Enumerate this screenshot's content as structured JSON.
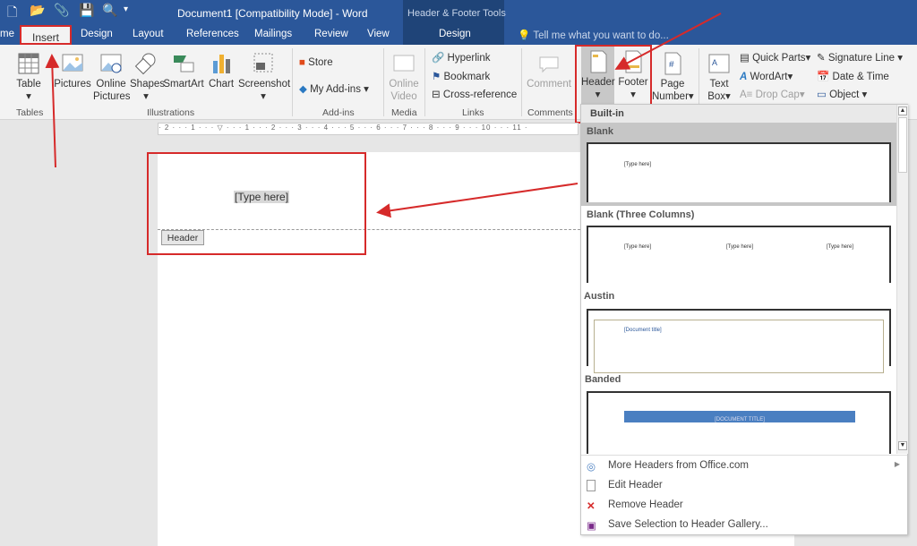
{
  "window": {
    "title": "Document1 [Compatibility Mode] - Word",
    "context_group": "Header & Footer Tools"
  },
  "tabs": [
    {
      "label": "me"
    },
    {
      "label": "Insert"
    },
    {
      "label": "Design"
    },
    {
      "label": "Layout"
    },
    {
      "label": "References"
    },
    {
      "label": "Mailings"
    },
    {
      "label": "Review"
    },
    {
      "label": "View"
    },
    {
      "label": "Design"
    }
  ],
  "tell_me": "Tell me what you want to do...",
  "ribbon": {
    "table": "Table",
    "pictures": "Pictures",
    "online_pictures": "Online Pictures",
    "shapes": "Shapes",
    "smartart": "SmartArt",
    "chart": "Chart",
    "screenshot": "Screenshot",
    "store": "Store",
    "my_addins": "My Add-ins",
    "online_video": "Online Video",
    "hyperlink": "Hyperlink",
    "bookmark": "Bookmark",
    "cross_reference": "Cross-reference",
    "comment": "Comment",
    "header": "Header",
    "footer": "Footer",
    "page_number": "Page Number",
    "text_box": "Text Box",
    "quick_parts": "Quick Parts",
    "wordart": "WordArt",
    "drop_cap": "Drop Cap",
    "signature_line": "Signature Line",
    "date_time": "Date & Time",
    "object": "Object",
    "groups": {
      "tables": "Tables",
      "illustrations": "Illustrations",
      "addins": "Add-ins",
      "media": "Media",
      "links": "Links",
      "comments": "Comments"
    }
  },
  "document": {
    "placeholder": "[Type here]",
    "header_tag": "Header"
  },
  "dropdown": {
    "section": "Built-in",
    "gallery": [
      {
        "name": "Blank",
        "texts": [
          "[Type here]"
        ]
      },
      {
        "name": "Blank (Three Columns)",
        "texts": [
          "[Type here]",
          "[Type here]",
          "[Type here]"
        ]
      },
      {
        "name": "Austin",
        "texts": [
          "[Document title]"
        ]
      },
      {
        "name": "Banded",
        "texts": [
          "[DOCUMENT TITLE]"
        ]
      }
    ],
    "items": [
      {
        "label": "More Headers from Office.com"
      },
      {
        "label": "Edit Header"
      },
      {
        "label": "Remove Header"
      },
      {
        "label": "Save Selection to Header Gallery..."
      }
    ]
  },
  "colors": {
    "title_bar": "#2b579a",
    "annotation": "#d62a2a",
    "banded": "#4a7fc1"
  }
}
